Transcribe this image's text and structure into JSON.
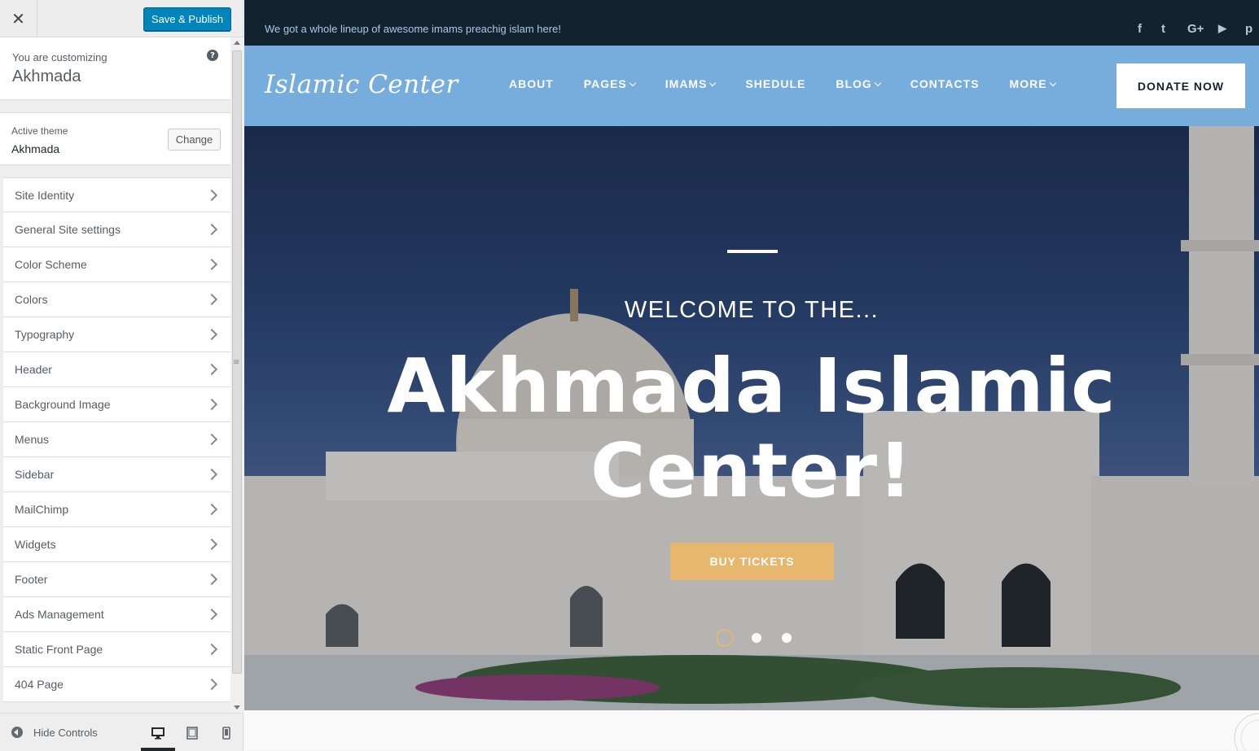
{
  "customizer": {
    "close_label": "✕",
    "save_label": "Save & Publish",
    "customizing_label": "You are customizing",
    "site_name": "Akhmada",
    "help_label": "?",
    "active_theme_label": "Active theme",
    "active_theme_name": "Akhmada",
    "change_label": "Change",
    "sections": [
      "Site Identity",
      "General Site settings",
      "Color Scheme",
      "Colors",
      "Typography",
      "Header",
      "Background Image",
      "Menus",
      "Sidebar",
      "MailChimp",
      "Widgets",
      "Footer",
      "Ads Management",
      "Static Front Page",
      "404 Page"
    ],
    "footer": {
      "hide_controls_label": "Hide Controls",
      "devices": [
        "desktop",
        "tablet",
        "mobile"
      ],
      "active_device": "desktop"
    }
  },
  "site": {
    "topbar_message": "We got a whole lineup of awesome imams preachig islam here!",
    "social_icons": [
      "facebook-icon",
      "twitter-icon",
      "google-plus-icon",
      "youtube-icon",
      "pinterest-icon"
    ],
    "social_glyphs": {
      "facebook": "f",
      "twitter": "t",
      "google": "G+",
      "youtube": "▶",
      "pinterest": "p"
    },
    "logo_text": "Islamic Center",
    "nav": [
      {
        "label": "ABOUT",
        "dropdown": false
      },
      {
        "label": "PAGES",
        "dropdown": true
      },
      {
        "label": "IMAMS",
        "dropdown": true
      },
      {
        "label": "SHEDULE",
        "dropdown": false
      },
      {
        "label": "BLOG",
        "dropdown": true
      },
      {
        "label": "CONTACTS",
        "dropdown": false
      },
      {
        "label": "MORE",
        "dropdown": true
      }
    ],
    "donate_label": "DONATE NOW",
    "hero": {
      "pretitle": "WELCOME TO THE...",
      "title": "Akhmada Islamic Center!",
      "button_label": "BUY TICKETS",
      "slides": 3,
      "active_slide": 1
    },
    "colors": {
      "topbar": "#13222f",
      "nav": "#76addc",
      "accent": "#e6b76d",
      "save_button": "#0085ba"
    }
  }
}
